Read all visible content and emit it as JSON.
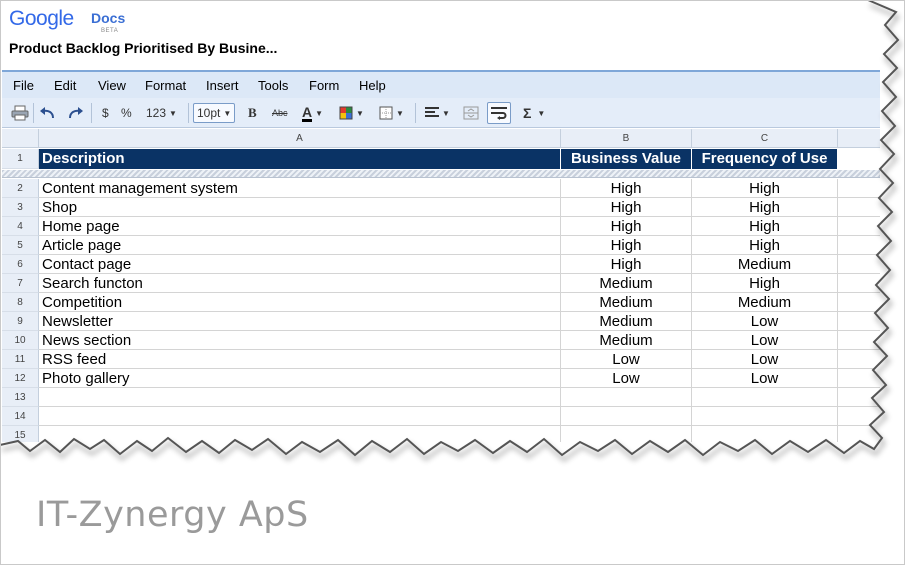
{
  "app": {
    "logo_google": "Google",
    "logo_docs": "Docs",
    "logo_beta": "BETA",
    "doc_title": "Product Backlog Prioritised By Busine..."
  },
  "menu": [
    "File",
    "Edit",
    "View",
    "Format",
    "Insert",
    "Tools",
    "Form",
    "Help"
  ],
  "toolbar": {
    "currency": "$",
    "percent": "%",
    "number_format": "123",
    "font_size": "10pt",
    "bold": "B",
    "strikethrough": "Abc",
    "text_color_glyph": "A",
    "sum": "Σ",
    "icons": [
      "print-icon",
      "undo-icon",
      "redo-icon",
      "text-color-icon",
      "background-color-icon",
      "borders-icon",
      "align-icon",
      "merge-cells-icon",
      "wrap-text-icon",
      "sum-icon"
    ]
  },
  "grid": {
    "columns": [
      "A",
      "B",
      "C"
    ],
    "row_numbers": [
      "1",
      "2",
      "3",
      "4",
      "5",
      "6",
      "7",
      "8",
      "9",
      "10",
      "11",
      "12",
      "13",
      "14",
      "15"
    ],
    "headers": [
      "Description",
      "Business Value",
      "Frequency of Use"
    ],
    "rows": [
      [
        "Content management system",
        "High",
        "High"
      ],
      [
        "Shop",
        "High",
        "High"
      ],
      [
        "Home page",
        "High",
        "High"
      ],
      [
        "Article page",
        "High",
        "High"
      ],
      [
        "Contact page",
        "High",
        "Medium"
      ],
      [
        "Search functon",
        "Medium",
        "High"
      ],
      [
        "Competition",
        "Medium",
        "Medium"
      ],
      [
        "Newsletter",
        "Medium",
        "Low"
      ],
      [
        "News section",
        "Medium",
        "Low"
      ],
      [
        "RSS feed",
        "Low",
        "Low"
      ],
      [
        "Photo gallery",
        "Low",
        "Low"
      ]
    ],
    "header_bg": "#0a3365"
  },
  "company": "IT-Zynergy ApS"
}
